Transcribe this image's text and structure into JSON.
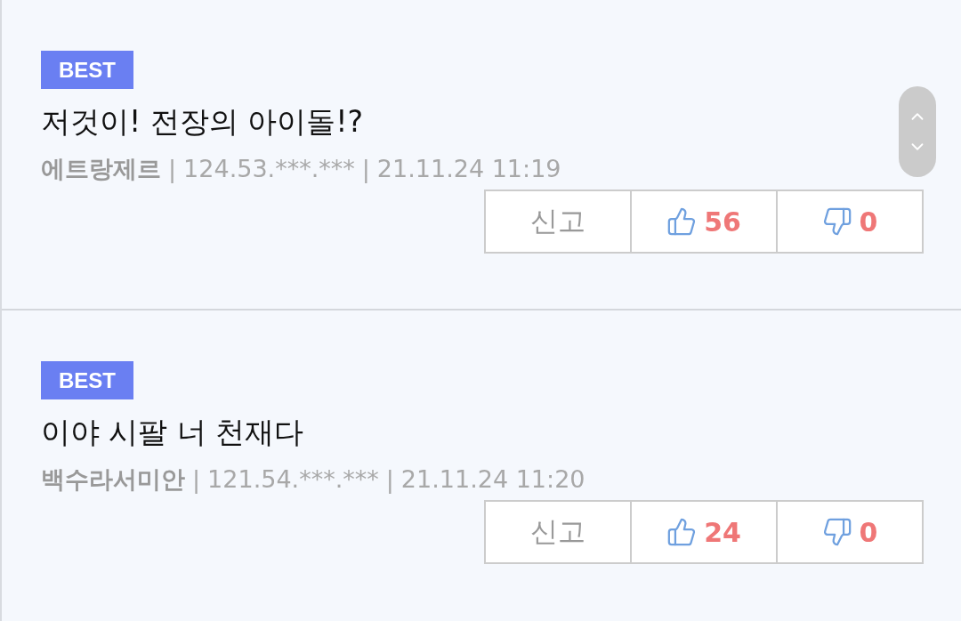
{
  "comments": [
    {
      "badge": "BEST",
      "text": "저것이! 전장의 아이돌!?",
      "meta": [
        {
          "kind": "author",
          "text": "에트랑제르"
        },
        {
          "kind": "separator",
          "text": "|"
        },
        {
          "kind": "ip",
          "text": "124.53.***.***"
        },
        {
          "kind": "separator",
          "text": "|"
        },
        {
          "kind": "date",
          "text": "21.11.24 11:19"
        }
      ],
      "report": "신고",
      "likes": "56",
      "dislikes": "0"
    },
    {
      "badge": "BEST",
      "text": "이야 시팔 너 천재다",
      "meta": [
        {
          "kind": "author",
          "text": "백수라서미안"
        },
        {
          "kind": "separator",
          "text": "|"
        },
        {
          "kind": "ip",
          "text": "121.54.***.***"
        },
        {
          "kind": "separator",
          "text": "|"
        },
        {
          "kind": "date",
          "text": "21.11.24 11:20"
        }
      ],
      "report": "신고",
      "likes": "24",
      "dislikes": "0"
    }
  ]
}
